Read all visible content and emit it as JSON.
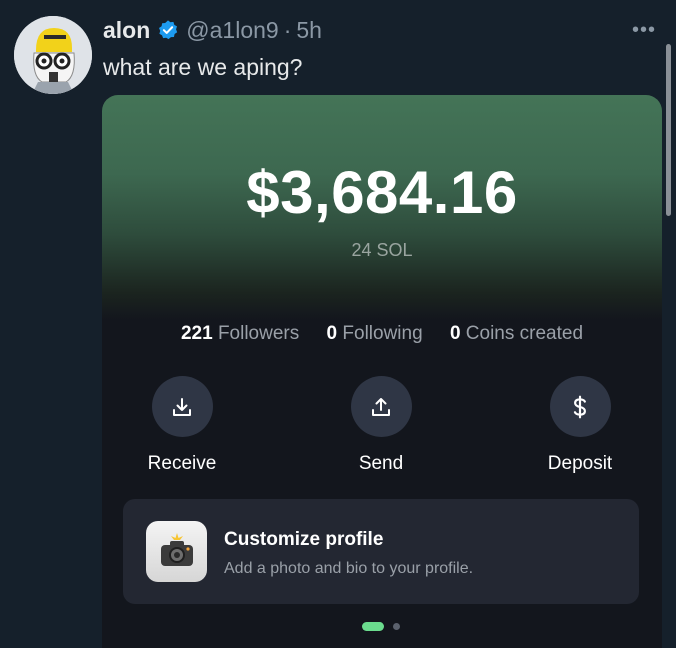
{
  "tweet": {
    "display_name": "alon",
    "handle": "@a1lon9",
    "separator": "·",
    "time": "5h",
    "text": "what are we aping?",
    "more_icon": "ellipsis-icon",
    "verified_icon": "verified-badge-icon",
    "verified_color": "#1d9bf0"
  },
  "card": {
    "balance": "$3,684.16",
    "sol_amount": "24 SOL",
    "stats": [
      {
        "value": "221",
        "label": "Followers"
      },
      {
        "value": "0",
        "label": "Following"
      },
      {
        "value": "0",
        "label": "Coins created"
      }
    ],
    "actions": [
      {
        "label": "Receive",
        "icon": "download-icon"
      },
      {
        "label": "Send",
        "icon": "upload-icon"
      },
      {
        "label": "Deposit",
        "icon": "dollar-icon"
      }
    ],
    "promo": {
      "title": "Customize profile",
      "subtitle": "Add a photo and bio to your profile.",
      "icon": "camera-icon"
    },
    "pager": {
      "pages": 2,
      "active": 1,
      "active_color": "#6bdc8e"
    },
    "hero_color": "#447457"
  }
}
